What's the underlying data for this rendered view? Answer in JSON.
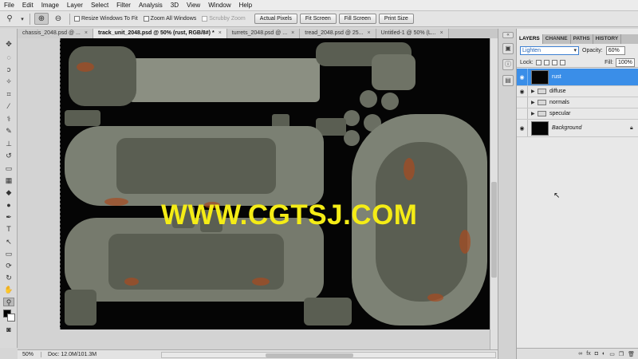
{
  "menu": [
    "File",
    "Edit",
    "Image",
    "Layer",
    "Select",
    "Filter",
    "Analysis",
    "3D",
    "View",
    "Window",
    "Help"
  ],
  "options": {
    "resize_windows": "Resize Windows To Fit",
    "zoom_all": "Zoom All Windows",
    "scrubby_zoom": "Scrubby Zoom",
    "actual_pixels": "Actual Pixels",
    "fit_screen": "Fit Screen",
    "fill_screen": "Fill Screen",
    "print_size": "Print Size"
  },
  "tabs": [
    {
      "label": "chassis_2048.psd @ ..."
    },
    {
      "label": "track_unit_2048.psd @ 50% (rust, RGB/8#) *"
    },
    {
      "label": "turrets_2048.psd @ ..."
    },
    {
      "label": "tread_2048.psd @ 25..."
    },
    {
      "label": "Untitled-1 @ 50% (L..."
    }
  ],
  "tab_close": "×",
  "watermark": "WWW.CGTSJ.COM",
  "status": {
    "zoom": "50%",
    "doc": "Doc: 12.0M/101.3M"
  },
  "panel": {
    "tabs": [
      "LAYERS",
      "CHANNE",
      "PATHS",
      "HISTORY"
    ],
    "blend_mode": "Lighten",
    "opacity_label": "Opacity:",
    "opacity": "60%",
    "lock_label": "Lock:",
    "fill_label": "Fill:",
    "fill": "100%",
    "layers": [
      {
        "name": "rust",
        "type": "layer",
        "selected": true
      },
      {
        "name": "diffuse",
        "type": "group"
      },
      {
        "name": "normals",
        "type": "group"
      },
      {
        "name": "specular",
        "type": "group"
      },
      {
        "name": "Background",
        "type": "background",
        "locked": true
      }
    ]
  },
  "colors": {
    "accent": "#3a8ee8",
    "watermark": "#f4ec16"
  }
}
